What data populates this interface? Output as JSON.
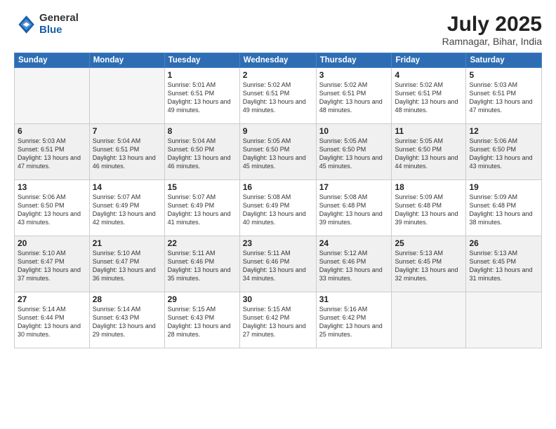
{
  "header": {
    "logo_general": "General",
    "logo_blue": "Blue",
    "month_title": "July 2025",
    "location": "Ramnagar, Bihar, India"
  },
  "weekdays": [
    "Sunday",
    "Monday",
    "Tuesday",
    "Wednesday",
    "Thursday",
    "Friday",
    "Saturday"
  ],
  "weeks": [
    [
      {
        "day": "",
        "empty": true
      },
      {
        "day": "",
        "empty": true
      },
      {
        "day": "1",
        "sunrise": "5:01 AM",
        "sunset": "6:51 PM",
        "daylight": "13 hours and 49 minutes."
      },
      {
        "day": "2",
        "sunrise": "5:02 AM",
        "sunset": "6:51 PM",
        "daylight": "13 hours and 49 minutes."
      },
      {
        "day": "3",
        "sunrise": "5:02 AM",
        "sunset": "6:51 PM",
        "daylight": "13 hours and 48 minutes."
      },
      {
        "day": "4",
        "sunrise": "5:02 AM",
        "sunset": "6:51 PM",
        "daylight": "13 hours and 48 minutes."
      },
      {
        "day": "5",
        "sunrise": "5:03 AM",
        "sunset": "6:51 PM",
        "daylight": "13 hours and 47 minutes."
      }
    ],
    [
      {
        "day": "6",
        "sunrise": "5:03 AM",
        "sunset": "6:51 PM",
        "daylight": "13 hours and 47 minutes."
      },
      {
        "day": "7",
        "sunrise": "5:04 AM",
        "sunset": "6:51 PM",
        "daylight": "13 hours and 46 minutes."
      },
      {
        "day": "8",
        "sunrise": "5:04 AM",
        "sunset": "6:50 PM",
        "daylight": "13 hours and 46 minutes."
      },
      {
        "day": "9",
        "sunrise": "5:05 AM",
        "sunset": "6:50 PM",
        "daylight": "13 hours and 45 minutes."
      },
      {
        "day": "10",
        "sunrise": "5:05 AM",
        "sunset": "6:50 PM",
        "daylight": "13 hours and 45 minutes."
      },
      {
        "day": "11",
        "sunrise": "5:05 AM",
        "sunset": "6:50 PM",
        "daylight": "13 hours and 44 minutes."
      },
      {
        "day": "12",
        "sunrise": "5:06 AM",
        "sunset": "6:50 PM",
        "daylight": "13 hours and 43 minutes."
      }
    ],
    [
      {
        "day": "13",
        "sunrise": "5:06 AM",
        "sunset": "6:50 PM",
        "daylight": "13 hours and 43 minutes."
      },
      {
        "day": "14",
        "sunrise": "5:07 AM",
        "sunset": "6:49 PM",
        "daylight": "13 hours and 42 minutes."
      },
      {
        "day": "15",
        "sunrise": "5:07 AM",
        "sunset": "6:49 PM",
        "daylight": "13 hours and 41 minutes."
      },
      {
        "day": "16",
        "sunrise": "5:08 AM",
        "sunset": "6:49 PM",
        "daylight": "13 hours and 40 minutes."
      },
      {
        "day": "17",
        "sunrise": "5:08 AM",
        "sunset": "6:48 PM",
        "daylight": "13 hours and 39 minutes."
      },
      {
        "day": "18",
        "sunrise": "5:09 AM",
        "sunset": "6:48 PM",
        "daylight": "13 hours and 39 minutes."
      },
      {
        "day": "19",
        "sunrise": "5:09 AM",
        "sunset": "6:48 PM",
        "daylight": "13 hours and 38 minutes."
      }
    ],
    [
      {
        "day": "20",
        "sunrise": "5:10 AM",
        "sunset": "6:47 PM",
        "daylight": "13 hours and 37 minutes."
      },
      {
        "day": "21",
        "sunrise": "5:10 AM",
        "sunset": "6:47 PM",
        "daylight": "13 hours and 36 minutes."
      },
      {
        "day": "22",
        "sunrise": "5:11 AM",
        "sunset": "6:46 PM",
        "daylight": "13 hours and 35 minutes."
      },
      {
        "day": "23",
        "sunrise": "5:11 AM",
        "sunset": "6:46 PM",
        "daylight": "13 hours and 34 minutes."
      },
      {
        "day": "24",
        "sunrise": "5:12 AM",
        "sunset": "6:46 PM",
        "daylight": "13 hours and 33 minutes."
      },
      {
        "day": "25",
        "sunrise": "5:13 AM",
        "sunset": "6:45 PM",
        "daylight": "13 hours and 32 minutes."
      },
      {
        "day": "26",
        "sunrise": "5:13 AM",
        "sunset": "6:45 PM",
        "daylight": "13 hours and 31 minutes."
      }
    ],
    [
      {
        "day": "27",
        "sunrise": "5:14 AM",
        "sunset": "6:44 PM",
        "daylight": "13 hours and 30 minutes."
      },
      {
        "day": "28",
        "sunrise": "5:14 AM",
        "sunset": "6:43 PM",
        "daylight": "13 hours and 29 minutes."
      },
      {
        "day": "29",
        "sunrise": "5:15 AM",
        "sunset": "6:43 PM",
        "daylight": "13 hours and 28 minutes."
      },
      {
        "day": "30",
        "sunrise": "5:15 AM",
        "sunset": "6:42 PM",
        "daylight": "13 hours and 27 minutes."
      },
      {
        "day": "31",
        "sunrise": "5:16 AM",
        "sunset": "6:42 PM",
        "daylight": "13 hours and 25 minutes."
      },
      {
        "day": "",
        "empty": true
      },
      {
        "day": "",
        "empty": true
      }
    ]
  ]
}
